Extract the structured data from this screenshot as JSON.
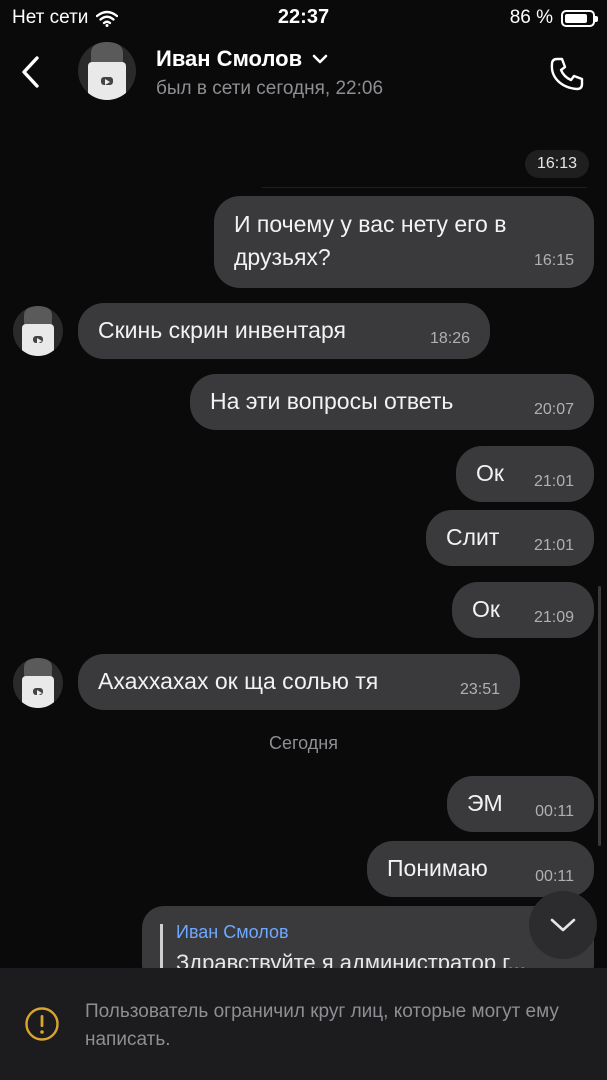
{
  "status": {
    "network": "Нет сети",
    "time": "22:37",
    "battery": "86 %",
    "battery_level": 0.86
  },
  "header": {
    "name": "Иван Смолов",
    "last_seen": "был в сети сегодня, 22:06"
  },
  "chat": {
    "date_pill": "16:13",
    "messages": [
      {
        "text": "И почему у вас нету его в",
        "text2": "друзьях?",
        "time": "16:15",
        "from": "me"
      },
      {
        "text": "Скинь скрин инвентаря",
        "time": "18:26",
        "from": "contact"
      },
      {
        "text": "На эти вопросы ответь",
        "time": "20:07",
        "from": "me"
      },
      {
        "text": "Ок",
        "time": "21:01",
        "from": "me"
      },
      {
        "text": "Слит",
        "time": "21:01",
        "from": "me"
      },
      {
        "text": "Ок",
        "time": "21:09",
        "from": "me"
      },
      {
        "text": "Ахаххахах ок ща солью тя",
        "time": "23:51",
        "from": "contact"
      },
      {
        "text": "ЭМ",
        "time": "00:11",
        "from": "me"
      },
      {
        "text": "Понимаю",
        "time": "00:11",
        "from": "me"
      }
    ],
    "day_separator": "Сегодня",
    "reply": {
      "author": "Иван Смолов",
      "text": "Здравствуйте я администратор г..."
    }
  },
  "footer": {
    "notice": "Пользователь ограничил круг лиц, которые могут ему написать."
  },
  "colors": {
    "background": "#0a0a0a",
    "bubble": "#3a3a3c",
    "reply_author": "#6ea8ff",
    "footer_bg": "#1c1c1e",
    "warning": "#d9a52f"
  }
}
